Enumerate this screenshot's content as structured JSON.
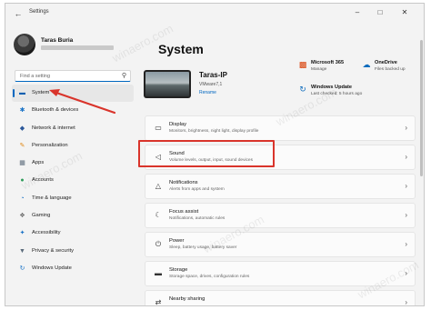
{
  "window": {
    "title": "Settings",
    "back_glyph": "←",
    "minimize_glyph": "–",
    "maximize_glyph": "□",
    "close_glyph": "✕"
  },
  "user": {
    "name": "Taras Buria"
  },
  "search": {
    "placeholder": "Find a setting",
    "icon": "search-icon"
  },
  "sidebar": {
    "items": [
      {
        "label": "System",
        "icon": "monitor-icon",
        "glyph": "▬",
        "color": "#0a5fb0",
        "active": true
      },
      {
        "label": "Bluetooth & devices",
        "icon": "bluetooth-icon",
        "glyph": "✱",
        "color": "#1a73c7",
        "active": false
      },
      {
        "label": "Network & internet",
        "icon": "network-icon",
        "glyph": "◆",
        "color": "#2b579a",
        "active": false
      },
      {
        "label": "Personalization",
        "icon": "brush-icon",
        "glyph": "✎",
        "color": "#e08a1a",
        "active": false
      },
      {
        "label": "Apps",
        "icon": "apps-icon",
        "glyph": "▦",
        "color": "#5a6a7a",
        "active": false
      },
      {
        "label": "Accounts",
        "icon": "person-icon",
        "glyph": "●",
        "color": "#2e9c5a",
        "active": false
      },
      {
        "label": "Time & language",
        "icon": "globe-clock-icon",
        "glyph": "◔",
        "color": "#1a73c7",
        "active": false
      },
      {
        "label": "Gaming",
        "icon": "gamepad-icon",
        "glyph": "❖",
        "color": "#6b6b6b",
        "active": false
      },
      {
        "label": "Accessibility",
        "icon": "accessibility-icon",
        "glyph": "✦",
        "color": "#1a73c7",
        "active": false
      },
      {
        "label": "Privacy & security",
        "icon": "shield-icon",
        "glyph": "▼",
        "color": "#5a6a7a",
        "active": false
      },
      {
        "label": "Windows Update",
        "icon": "update-icon",
        "glyph": "↻",
        "color": "#1a73c7",
        "active": false
      }
    ]
  },
  "main": {
    "title": "System",
    "device": {
      "name": "Taras-IP",
      "model": "VMware7,1",
      "rename_label": "Rename"
    },
    "tiles": [
      {
        "title": "Microsoft 365",
        "subtitle": "Manage",
        "icon": "microsoft-365-icon",
        "glyph": "▩",
        "color": "#d83b01"
      },
      {
        "title": "OneDrive",
        "subtitle": "Files backed up",
        "icon": "onedrive-icon",
        "glyph": "☁",
        "color": "#0f6cbd"
      },
      {
        "title": "Windows Update",
        "subtitle": "Last checked: 5 hours ago",
        "icon": "windows-update-icon",
        "glyph": "↻",
        "color": "#0f6cbd"
      }
    ],
    "cards": [
      {
        "title": "Display",
        "subtitle": "Monitors, brightness, night light, display profile",
        "icon": "display-icon",
        "glyph": "▭"
      },
      {
        "title": "Sound",
        "subtitle": "Volume levels, output, input, sound devices",
        "icon": "speaker-icon",
        "glyph": "◁"
      },
      {
        "title": "Notifications",
        "subtitle": "Alerts from apps and system",
        "icon": "bell-icon",
        "glyph": "△"
      },
      {
        "title": "Focus assist",
        "subtitle": "Notifications, automatic rules",
        "icon": "moon-icon",
        "glyph": "☾"
      },
      {
        "title": "Power",
        "subtitle": "Sleep, battery usage, battery saver",
        "icon": "power-icon",
        "glyph": "⏻"
      },
      {
        "title": "Storage",
        "subtitle": "Storage space, drives, configuration rules",
        "icon": "storage-icon",
        "glyph": "▬"
      },
      {
        "title": "Nearby sharing",
        "subtitle": "",
        "icon": "share-icon",
        "glyph": "⇄"
      }
    ],
    "chevron": "›"
  },
  "watermark": "winaero.com",
  "colors": {
    "accent": "#0067c0",
    "annotation": "#d9342b"
  }
}
